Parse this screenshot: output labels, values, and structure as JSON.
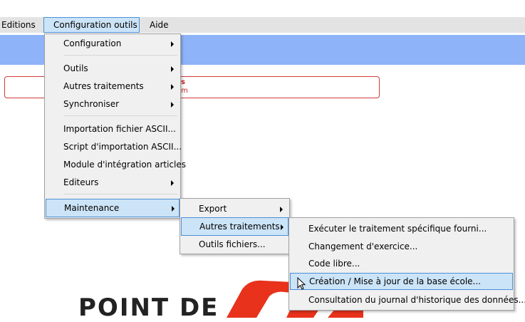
{
  "menubar": {
    "items": [
      {
        "label": "Editions",
        "active": false
      },
      {
        "label": "Configuration outils",
        "active": true
      },
      {
        "label": "Aide",
        "active": false
      }
    ]
  },
  "alert": {
    "line1": "s",
    "line2": "m"
  },
  "logo": {
    "text": "POINT DE",
    "color": "#e8321c"
  },
  "menus": {
    "config": {
      "items": [
        {
          "label": "Configuration",
          "submenu": true
        },
        {
          "label": "Outils",
          "submenu": true
        },
        {
          "label": "Autres traitements",
          "submenu": true
        },
        {
          "label": "Synchroniser",
          "submenu": true
        },
        {
          "label": "Importation fichier ASCII...",
          "submenu": false
        },
        {
          "label": "Script d'importation ASCII...",
          "submenu": false
        },
        {
          "label": "Module d'intégration articles",
          "submenu": false
        },
        {
          "label": "Editeurs",
          "submenu": true
        },
        {
          "label": "Maintenance",
          "submenu": true,
          "highlighted": true
        }
      ]
    },
    "maintenance": {
      "items": [
        {
          "label": "Export",
          "submenu": true
        },
        {
          "label": "Autres traitements",
          "submenu": true,
          "highlighted": true
        },
        {
          "label": "Outils fichiers...",
          "submenu": false
        }
      ]
    },
    "autres": {
      "items": [
        {
          "label": "Exécuter le traitement spécifique fourni...",
          "submenu": false
        },
        {
          "label": "Changement d'exercice...",
          "submenu": false
        },
        {
          "label": "Code libre...",
          "submenu": false
        },
        {
          "label": "Création / Mise à jour de la base école...",
          "submenu": false,
          "highlighted": true
        },
        {
          "label": "Consultation du journal d'historique des données...",
          "submenu": false
        }
      ]
    }
  },
  "colors": {
    "menubar_bg": "#e3e3e3",
    "highlight_bg": "#cce4f7",
    "highlight_border": "#4d8fd6",
    "band": "#8fb3f9",
    "alert_border": "#cf3b3b"
  }
}
